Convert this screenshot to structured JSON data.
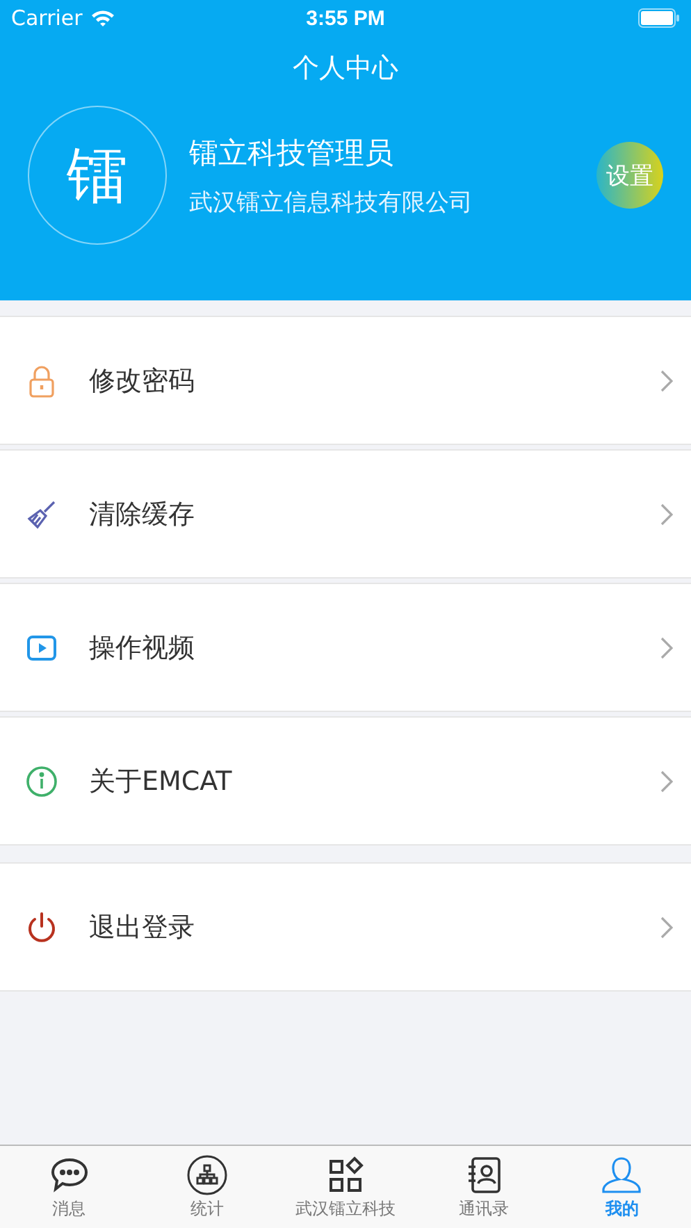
{
  "status_bar": {
    "carrier": "Carrier",
    "time": "3:55 PM"
  },
  "title": "个人中心",
  "profile": {
    "avatar_char": "镭",
    "name": "镭立科技管理员",
    "company": "武汉镭立信息科技有限公司",
    "settings_button": "设置"
  },
  "menu_groups": [
    [
      {
        "kind": "lock",
        "label": "修改密码"
      },
      {
        "kind": "brush",
        "label": "清除缓存"
      },
      {
        "kind": "video",
        "label": "操作视频"
      },
      {
        "kind": "info",
        "label": "关于EMCAT"
      }
    ],
    [
      {
        "kind": "power",
        "label": "退出登录"
      }
    ]
  ],
  "tab_bar": [
    {
      "kind": "chat",
      "label": "消息",
      "selected": false
    },
    {
      "kind": "org",
      "label": "统计",
      "selected": false
    },
    {
      "kind": "apps",
      "label": "武汉镭立科技",
      "selected": false
    },
    {
      "kind": "contacts",
      "label": "通讯录",
      "selected": false
    },
    {
      "kind": "person",
      "label": "我的",
      "selected": true
    }
  ]
}
